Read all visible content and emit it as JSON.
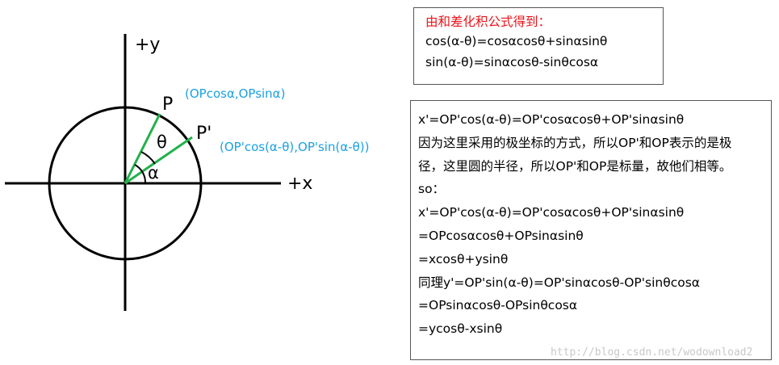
{
  "diagram": {
    "y_axis_label": "+y",
    "x_axis_label": "+x",
    "point_p_label": "P",
    "point_p_prime_label": "P'",
    "angle_alpha_label": "α",
    "angle_theta_label": "θ",
    "p_coords": "(OPcosα,OPsinα)",
    "p_prime_coords": "(OP'cos(α-θ),OP'sin(α-θ))",
    "colors": {
      "radius_lines": "#22b14c",
      "coords_text": "#1ba1e2",
      "axes": "#000000"
    }
  },
  "formula_box": {
    "title": "由和差化积公式得到：",
    "lines": [
      "cos(α-θ)=cosαcosθ+sinαsinθ",
      "sin(α-θ)=sinαcosθ-sinθcosα"
    ],
    "title_color": "#e8141b"
  },
  "derivation_box": {
    "lines": [
      "x'=OP'cos(α-θ)=OP'cosαcosθ+OP'sinαsinθ",
      "因为这里采用的极坐标的方式，所以OP'和OP表示的是极",
      "径，这里圆的半径，所以OP'和OP是标量，故他们相等。",
      "so：",
      "x'=OP'cos(α-θ)=OP'cosαcosθ+OP'sinαsinθ",
      "=OPcosαcosθ+OPsinαsinθ",
      "=xcosθ+ysinθ",
      "同理y'=OP'sin(α-θ)=OP'sinαcosθ-OP'sinθcosα",
      "=OPsinαcosθ-OPsinθcosα",
      "=ycosθ-xsinθ"
    ]
  },
  "watermark": "http://blog.csdn.net/wodownload2"
}
